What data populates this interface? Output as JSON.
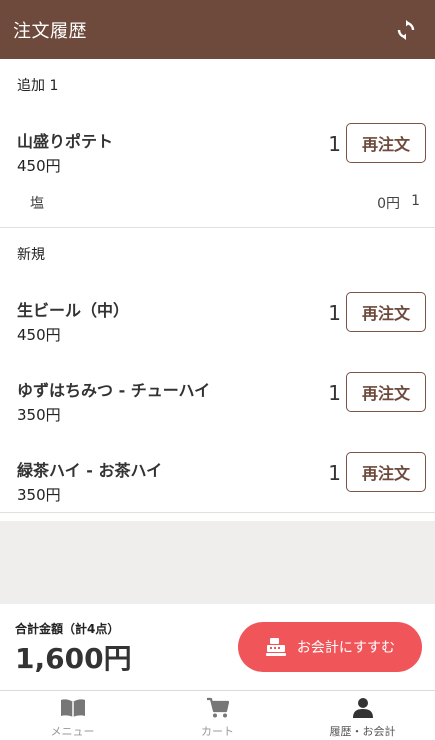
{
  "header": {
    "title": "注文履歴",
    "refresh_icon": "refresh-icon"
  },
  "sections": [
    {
      "label": "追加 1",
      "items": [
        {
          "name": "山盛りポテト",
          "price": "450円",
          "qty": "1",
          "button": "再注文",
          "options": [
            {
              "name": "塩",
              "price": "0円",
              "qty": "1"
            }
          ]
        }
      ]
    },
    {
      "label": "新規",
      "items": [
        {
          "name": "生ビール（中）",
          "price": "450円",
          "qty": "1",
          "button": "再注文"
        },
        {
          "name": "ゆずはちみつ - チューハイ",
          "price": "350円",
          "qty": "1",
          "button": "再注文"
        },
        {
          "name": "緑茶ハイ - お茶ハイ",
          "price": "350円",
          "qty": "1",
          "button": "再注文"
        }
      ]
    }
  ],
  "footer": {
    "total_label": "合計金額（計4点）",
    "total_amount": "1,600円",
    "checkout_label": "お会計にすすむ",
    "checkout_icon": "cash-register-icon",
    "accent_color": "#f0555a"
  },
  "tabs": [
    {
      "label": "メニュー",
      "icon": "book-icon",
      "active": false
    },
    {
      "label": "カート",
      "icon": "cart-icon",
      "active": false
    },
    {
      "label": "履歴・お会計",
      "icon": "user-icon",
      "active": true
    }
  ],
  "colors": {
    "brand": "#6e4a3c",
    "accent": "#f0555a"
  }
}
